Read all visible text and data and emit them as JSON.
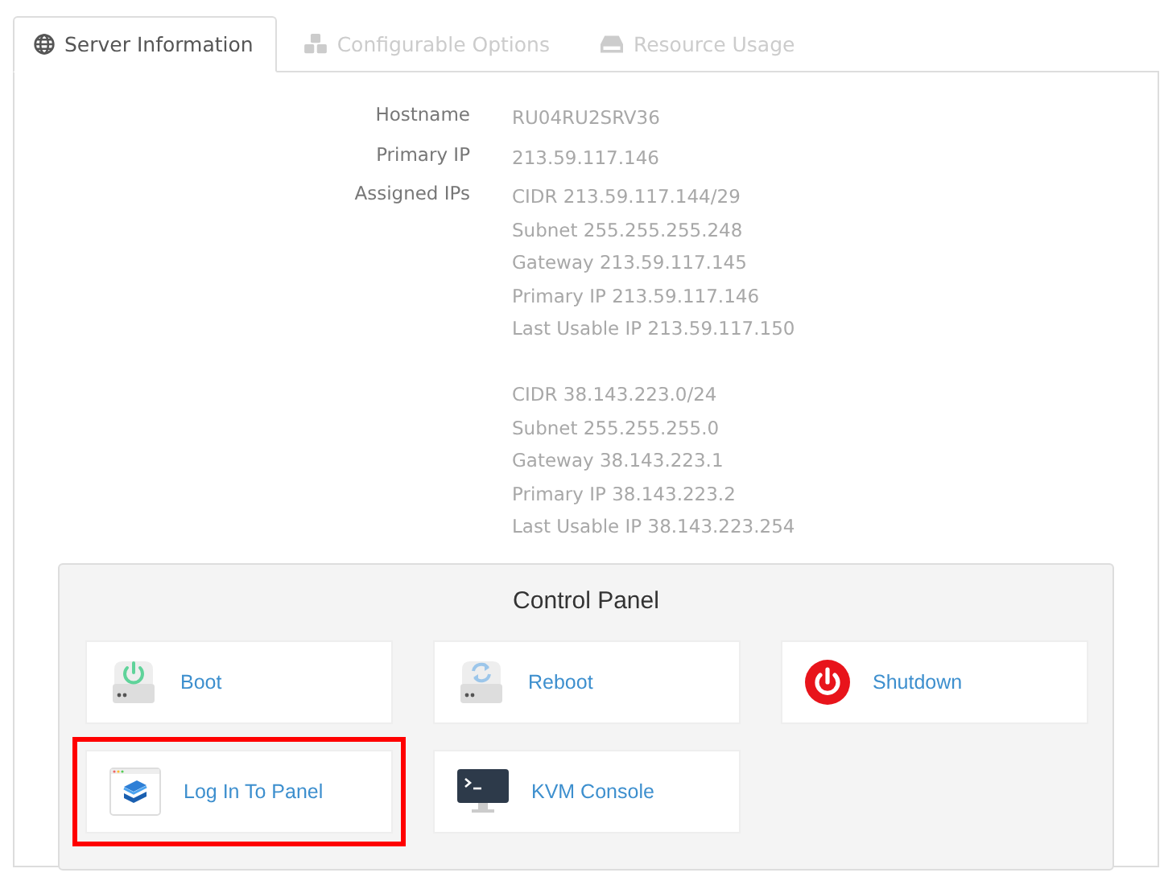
{
  "tabs": [
    {
      "label": "Server Information",
      "selected": true
    },
    {
      "label": "Configurable Options",
      "selected": false
    },
    {
      "label": "Resource Usage",
      "selected": false
    }
  ],
  "server_info": {
    "fields": [
      {
        "label": "Hostname",
        "groups": [
          [
            "RU04RU2SRV36"
          ]
        ]
      },
      {
        "label": "Primary IP",
        "groups": [
          [
            "213.59.117.146"
          ]
        ]
      },
      {
        "label": "Assigned IPs",
        "groups": [
          [
            "CIDR 213.59.117.144/29",
            "Subnet 255.255.255.248",
            "Gateway 213.59.117.145",
            "Primary IP 213.59.117.146",
            "Last Usable IP 213.59.117.150"
          ],
          [
            "CIDR 38.143.223.0/24",
            "Subnet 255.255.255.0",
            "Gateway 38.143.223.1",
            "Primary IP 38.143.223.2",
            "Last Usable IP 38.143.223.254"
          ]
        ]
      }
    ]
  },
  "control_panel": {
    "title": "Control Panel",
    "buttons": [
      {
        "label": "Boot",
        "kind": "boot",
        "highlighted": false
      },
      {
        "label": "Reboot",
        "kind": "reboot",
        "highlighted": false
      },
      {
        "label": "Shutdown",
        "kind": "shutdown",
        "highlighted": false
      },
      {
        "label": "Log In To Panel",
        "kind": "panel",
        "highlighted": true
      },
      {
        "label": "KVM Console",
        "kind": "console",
        "highlighted": false
      }
    ]
  }
}
